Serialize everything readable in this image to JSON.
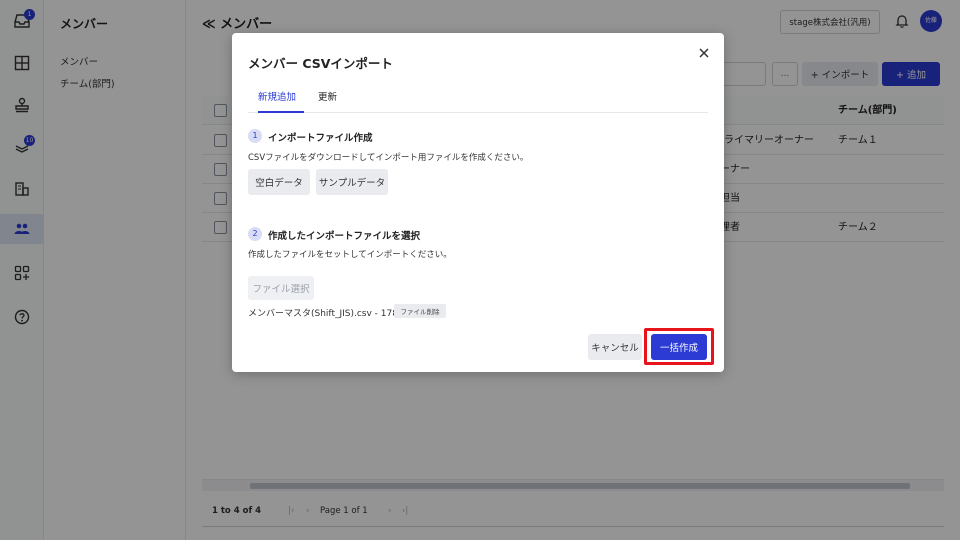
{
  "rail": {
    "inbox_badge": "1",
    "settings_badge": "10"
  },
  "subnav": {
    "title": "メンバー",
    "items": [
      {
        "label": "メンバー"
      },
      {
        "label": "チーム(部門)"
      }
    ]
  },
  "main": {
    "title": "メンバー",
    "company_label": "stage株式会社(汎用)",
    "avatar_label": "佐藤",
    "toolbar": {
      "small_label": "...",
      "import_label": "+ インポート",
      "add_label": "+ 追加"
    },
    "table": {
      "columns": [
        "",
        "チーム(部門)"
      ],
      "rows": [
        {
          "role": "プライマリーオーナー",
          "team": "チーム１"
        },
        {
          "role": "ーナー",
          "team": ""
        },
        {
          "role": "担当",
          "team": ""
        },
        {
          "role": "理者",
          "team": "チーム２"
        }
      ]
    },
    "pager": {
      "range": "1 to 4 of 4",
      "page_text": "Page 1 of 1"
    }
  },
  "modal": {
    "title": "メンバー CSVインポート",
    "tabs": [
      {
        "label": "新規追加",
        "active": true
      },
      {
        "label": "更新",
        "active": false
      }
    ],
    "step1": {
      "num": "1",
      "title": "インポートファイル作成",
      "desc": "CSVファイルをダウンロードしてインポート用ファイルを作成ください。",
      "blank_label": "空白データ",
      "sample_label": "サンプルデータ"
    },
    "step2": {
      "num": "2",
      "title": "作成したインポートファイルを選択",
      "desc": "作成したファイルをセットしてインポートください。",
      "file_button_label": "ファイル選択",
      "file_name": "メンバーマスタ(Shift_JIS).csv - 178 KB",
      "file_delete_label": "ファイル削除"
    },
    "cancel_label": "キャンセル",
    "submit_label": "一括作成"
  },
  "colors": {
    "primary": "#2b3bd4",
    "highlight": "#e8141b"
  }
}
